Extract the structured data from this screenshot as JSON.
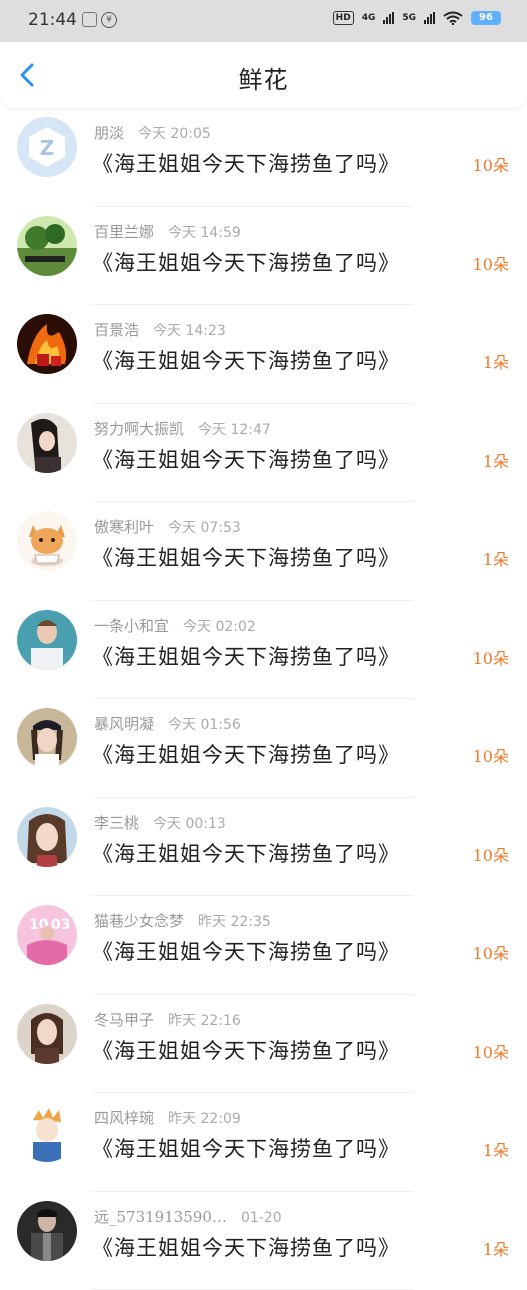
{
  "status_bar": {
    "time": "21:44",
    "battery": "96",
    "network_1": "4G",
    "network_2": "5G",
    "hd_label": "HD"
  },
  "header": {
    "title": "鲜花",
    "back_icon": "chevron-left-icon"
  },
  "colors": {
    "accent": "#2a8ff0",
    "count": "#f07a2a",
    "battery": "#5fb0ff"
  },
  "items": [
    {
      "name": "朋淡",
      "time": "今天 20:05",
      "message": "《海王姐姐今天下海捞鱼了吗》",
      "count": "10朵",
      "avatar": "app-logo-avatar"
    },
    {
      "name": "百里兰娜",
      "time": "今天 14:59",
      "message": "《海王姐姐今天下海捞鱼了吗》",
      "count": "10朵",
      "avatar": "landscape-avatar"
    },
    {
      "name": "百景浩",
      "time": "今天 14:23",
      "message": "《海王姐姐今天下海捞鱼了吗》",
      "count": "1朵",
      "avatar": "fire-avatar"
    },
    {
      "name": "努力啊大振凯",
      "time": "今天 12:47",
      "message": "《海王姐姐今天下海捞鱼了吗》",
      "count": "1朵",
      "avatar": "girl-avatar"
    },
    {
      "name": "傲寒利叶",
      "time": "今天 07:53",
      "message": "《海王姐姐今天下海捞鱼了吗》",
      "count": "1朵",
      "avatar": "cat-avatar"
    },
    {
      "name": "一条小和宜",
      "time": "今天 02:02",
      "message": "《海王姐姐今天下海捞鱼了吗》",
      "count": "10朵",
      "avatar": "boy-avatar"
    },
    {
      "name": "暴风明凝",
      "time": "今天 01:56",
      "message": "《海王姐姐今天下海捞鱼了吗》",
      "count": "10朵",
      "avatar": "cap-girl-avatar"
    },
    {
      "name": "李三桃",
      "time": "今天 00:13",
      "message": "《海王姐姐今天下海捞鱼了吗》",
      "count": "10朵",
      "avatar": "woman-avatar"
    },
    {
      "name": "猫巷少女念梦",
      "time": "昨天 22:35",
      "message": "《海王姐姐今天下海捞鱼了吗》",
      "count": "10朵",
      "avatar": "birthday-avatar"
    },
    {
      "name": "冬马甲子",
      "time": "昨天 22:16",
      "message": "《海王姐姐今天下海捞鱼了吗》",
      "count": "10朵",
      "avatar": "woman2-avatar"
    },
    {
      "name": "四风梓琬",
      "time": "昨天 22:09",
      "message": "《海王姐姐今天下海捞鱼了吗》",
      "count": "1朵",
      "avatar": "anime-avatar"
    },
    {
      "name": "远_5731913590…",
      "time": "01-20",
      "message": "《海王姐姐今天下海捞鱼了吗》",
      "count": "1朵",
      "avatar": "man-avatar"
    }
  ]
}
